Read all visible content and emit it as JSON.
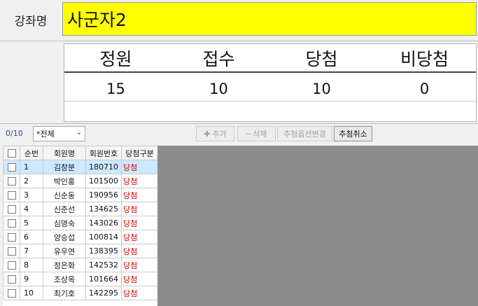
{
  "course": {
    "label": "강좌명",
    "value": "사군자2"
  },
  "stats": {
    "headers": [
      "정원",
      "접수",
      "당첨",
      "비당첨"
    ],
    "values": [
      "15",
      "10",
      "10",
      "0"
    ]
  },
  "toolbar": {
    "count": "0/10",
    "filter_selected": "*전체",
    "add_label": "추가",
    "delete_label": "삭제",
    "option_change_label": "추첨옵션변경",
    "cancel_draw_label": "추첨취소"
  },
  "grid": {
    "columns": [
      "순번",
      "회원명",
      "회원번호",
      "당첨구분"
    ],
    "rows": [
      {
        "no": "1",
        "name": "김창분",
        "id": "180710",
        "status": "당첨"
      },
      {
        "no": "2",
        "name": "박인홍",
        "id": "101500",
        "status": "당첨"
      },
      {
        "no": "3",
        "name": "신순동",
        "id": "190956",
        "status": "당첨"
      },
      {
        "no": "4",
        "name": "신준선",
        "id": "134625",
        "status": "당첨"
      },
      {
        "no": "5",
        "name": "심영숙",
        "id": "143026",
        "status": "당첨"
      },
      {
        "no": "6",
        "name": "양승섭",
        "id": "100814",
        "status": "당첨"
      },
      {
        "no": "7",
        "name": "유우연",
        "id": "138395",
        "status": "당첨"
      },
      {
        "no": "8",
        "name": "정은화",
        "id": "142532",
        "status": "당첨"
      },
      {
        "no": "9",
        "name": "조상옥",
        "id": "101664",
        "status": "당첨"
      },
      {
        "no": "10",
        "name": "최기호",
        "id": "142295",
        "status": "당첨"
      }
    ]
  }
}
